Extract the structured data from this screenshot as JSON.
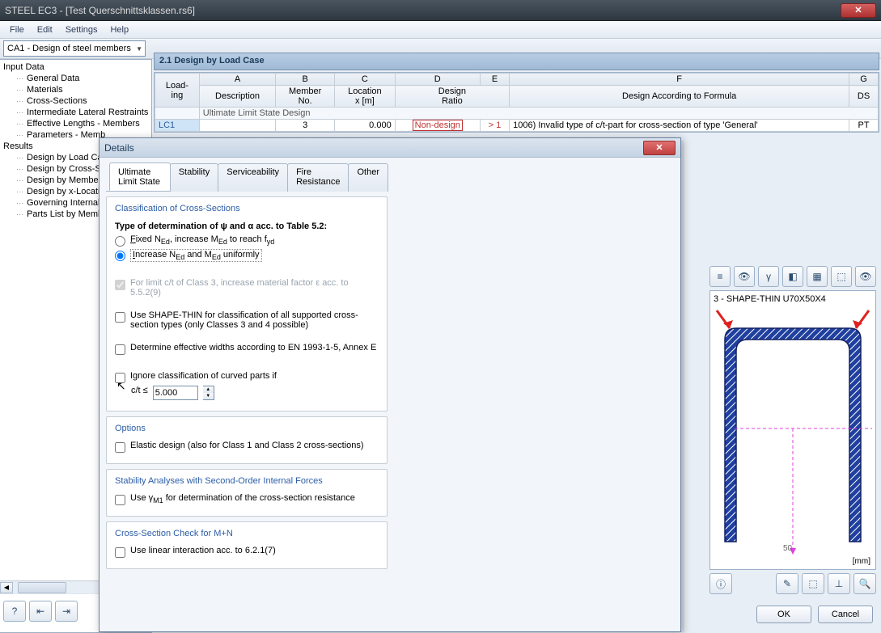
{
  "window": {
    "title": "STEEL EC3 - [Test Querschnittsklassen.rs6]"
  },
  "menu": {
    "file": "File",
    "edit": "Edit",
    "settings": "Settings",
    "help": "Help"
  },
  "toolbar": {
    "case_combo": "CA1 - Design of steel members"
  },
  "nav": {
    "input_data": "Input Data",
    "general_data": "General Data",
    "materials": "Materials",
    "cross_sections": "Cross-Sections",
    "ilr": "Intermediate Lateral Restraints",
    "eff_len": "Effective Lengths - Members",
    "params": "Parameters - Memb",
    "results": "Results",
    "by_loadcase": "Design by Load Ca",
    "by_cs": "Design by Cross-Se",
    "by_member": "Design by Member",
    "by_x": "Design by x-Locati",
    "gov": "Governing Internal",
    "parts": "Parts List by Memb"
  },
  "content": {
    "heading": "2.1 Design by Load Case",
    "cols": {
      "A": "A",
      "B": "B",
      "C": "C",
      "D": "D",
      "E": "E",
      "F": "F",
      "G": "G"
    },
    "headers": {
      "loading": "Load-\ning",
      "description": "Description",
      "member_no": "Member\nNo.",
      "location": "Location\nx [m]",
      "design_ratio": "Design\nRatio",
      "formula": "Design According to Formula",
      "ds": "DS"
    },
    "section_row": "Ultimate Limit State Design",
    "row1": {
      "lc": "LC1",
      "member": "3",
      "x": "0.000",
      "ratio": "Non-design",
      "gt": "> 1",
      "msg": "1006) Invalid type of c/t-part for cross-section of type 'General'",
      "ds": "PT"
    }
  },
  "right": {
    "cs_title": "3 - SHAPE-THIN U70X50X4",
    "dim": "50",
    "unit": "[mm]"
  },
  "buttons": {
    "ok": "OK",
    "cancel": "Cancel"
  },
  "details": {
    "title": "Details",
    "tabs": {
      "uls": "Ultimate Limit State",
      "stability": "Stability",
      "service": "Serviceability",
      "fire": "Fire Resistance",
      "other": "Other"
    },
    "section1": {
      "legend": "Classification of Cross-Sections",
      "heading": "Type of determination of ψ and α acc. to Table 5.2:",
      "opt1": "Fixed NEd, increase MEd to reach fyd",
      "opt2": "Increase NEd and MEd uniformly",
      "chk1": "For limit c/t of Class 3, increase material factor ε acc. to 5.5.2(9)",
      "chk2": "Use SHAPE-THIN for classification of all supported cross-section types (only Classes 3 and 4 possible)",
      "chk3": "Determine effective widths according to EN 1993-1-5, Annex E",
      "chk4": "Ignore classification of curved parts if",
      "ct_label": "c/t ≤",
      "ct_value": "5.000"
    },
    "section2": {
      "legend": "Options",
      "chk1": "Elastic design (also for Class 1 and Class 2 cross-sections)"
    },
    "section3": {
      "legend": "Stability Analyses with Second-Order Internal Forces",
      "chk1": "Use γM1 for determination of the cross-section resistance"
    },
    "section4": {
      "legend": "Cross-Section Check for M+N",
      "chk1": "Use linear interaction acc. to 6.2.1(7)"
    }
  }
}
